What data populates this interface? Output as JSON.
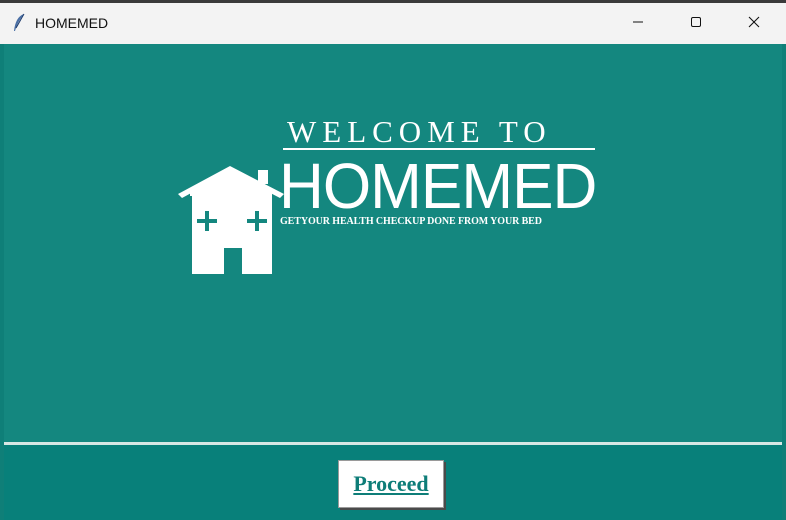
{
  "window": {
    "title": "HOMEMED",
    "icons": {
      "app": "feather-icon",
      "minimize": "minimize-icon",
      "maximize": "maximize-icon",
      "close": "close-icon"
    }
  },
  "splash": {
    "welcome_text": "WELCOME TO",
    "brand_name": "HOMEMED",
    "tagline": "GETYOUR HEALTH CHECKUP DONE FROM YOUR BED",
    "logo_icon": "house-medical-icon"
  },
  "footer": {
    "proceed_label": "Proceed"
  },
  "colors": {
    "background": "#14877f",
    "footer": "#08807a",
    "accent_text": "#0e7d78",
    "white": "#ffffff"
  }
}
